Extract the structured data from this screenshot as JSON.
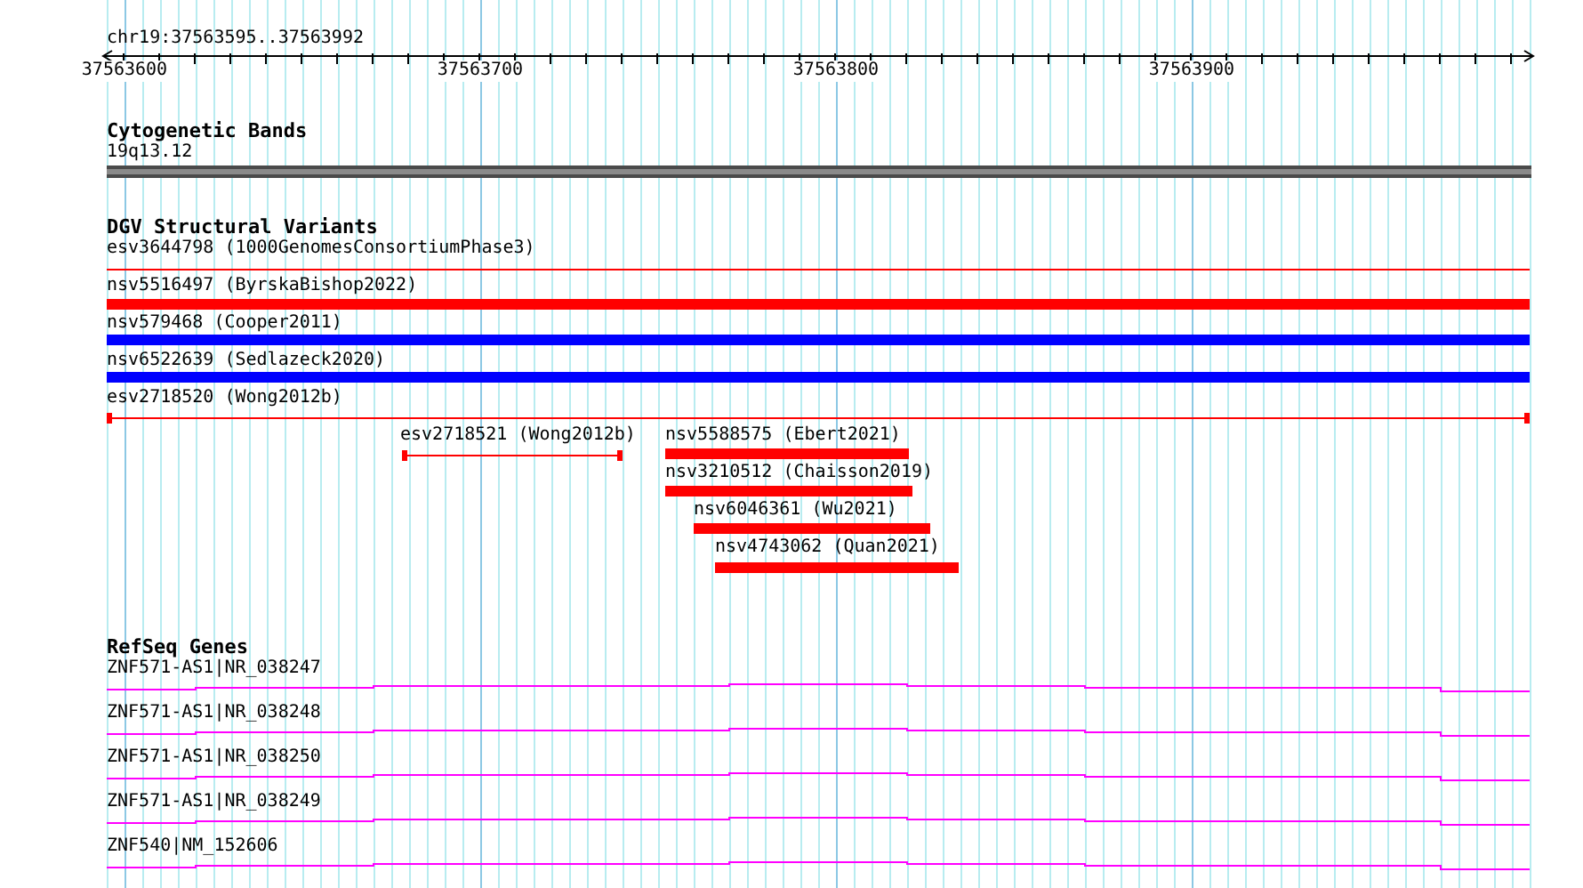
{
  "ruler": {
    "location": "chr19:37563595..37563992",
    "tick_labels": [
      "37563600",
      "37563700",
      "37563800",
      "37563900"
    ]
  },
  "tracks": [
    {
      "kind": "cytoband",
      "title": "Cytogenetic Bands",
      "features": [
        {
          "label": "19q13.12"
        }
      ]
    },
    {
      "kind": "variants",
      "title": "DGV Structural Variants",
      "features": [
        {
          "label": "esv3644798 (1000GenomesConsortiumPhase3)",
          "kind": "line",
          "color": "#ff0000"
        },
        {
          "label": "nsv5516497 (ByrskaBishop2022)",
          "kind": "bar",
          "color": "#ff0000"
        },
        {
          "label": "nsv579468 (Cooper2011)",
          "kind": "bar",
          "color": "#0000ff"
        },
        {
          "label": "nsv6522639 (Sedlazeck2020)",
          "kind": "bar",
          "color": "#0000ff"
        },
        {
          "label": "esv2718520 (Wong2012b)",
          "kind": "capped",
          "color": "#ff0000"
        },
        {
          "label": "esv2718521 (Wong2012b)",
          "kind": "capped",
          "color": "#ff0000"
        },
        {
          "label": "nsv5588575 (Ebert2021)",
          "kind": "bar",
          "color": "#ff0000"
        },
        {
          "label": "nsv3210512 (Chaisson2019)",
          "kind": "bar",
          "color": "#ff0000"
        },
        {
          "label": "nsv6046361 (Wu2021)",
          "kind": "bar",
          "color": "#ff0000"
        },
        {
          "label": "nsv4743062 (Quan2021)",
          "kind": "bar",
          "color": "#ff0000"
        }
      ]
    },
    {
      "kind": "genes",
      "title": "RefSeq Genes",
      "features": [
        {
          "label": "ZNF571-AS1|NR_038247"
        },
        {
          "label": "ZNF571-AS1|NR_038248"
        },
        {
          "label": "ZNF571-AS1|NR_038250"
        },
        {
          "label": "ZNF571-AS1|NR_038249"
        },
        {
          "label": "ZNF540|NM_152606"
        }
      ]
    }
  ]
}
